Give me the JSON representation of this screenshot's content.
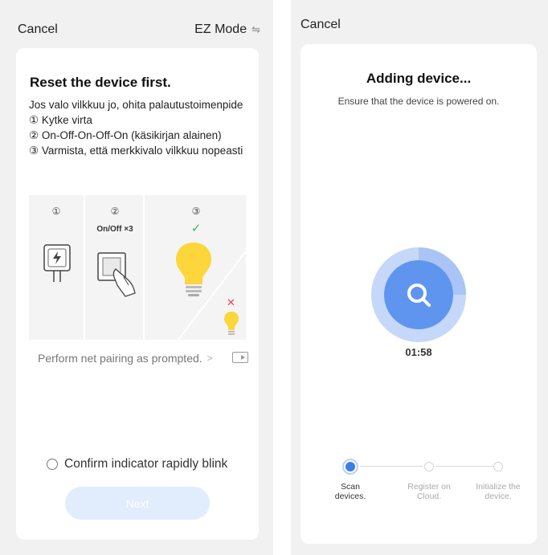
{
  "left": {
    "cancel_label": "Cancel",
    "mode_label": "EZ Mode",
    "mode_icon": "swap-arrows-icon",
    "card": {
      "title": "Reset the device first.",
      "steps": [
        "Jos valo vilkkuu jo, ohita palautustoimenpide",
        "① Kytke virta",
        "② On-Off-On-Off-On (käsikirjan alainen)",
        "③ Varmista, että merkkivalo vilkkuu nopeasti"
      ],
      "illustration": {
        "step1": "①",
        "step2": "②",
        "step2_caption": "On/Off ×3",
        "step3": "③"
      },
      "prompt_text": "Perform net pairing as prompted.",
      "prompt_chevron": ">",
      "confirm_label": "Confirm indicator rapidly blink",
      "next_label": "Next"
    },
    "colors": {
      "bulb": "#fcd63a",
      "check": "#3cb850",
      "cross": "#e5454a",
      "next_disabled": "#e1ecfc"
    }
  },
  "right": {
    "cancel_label": "Cancel",
    "card": {
      "title": "Adding device...",
      "subtitle": "Ensure that the device is powered on.",
      "timer": "01:58",
      "steps": [
        {
          "label": "Scan devices.",
          "state": "active"
        },
        {
          "label": "Register on Cloud.",
          "state": "pending"
        },
        {
          "label": "Initialize the device.",
          "state": "pending"
        }
      ]
    },
    "colors": {
      "accent": "#3c7ee8",
      "accent_light": "#bcd0f7"
    }
  }
}
